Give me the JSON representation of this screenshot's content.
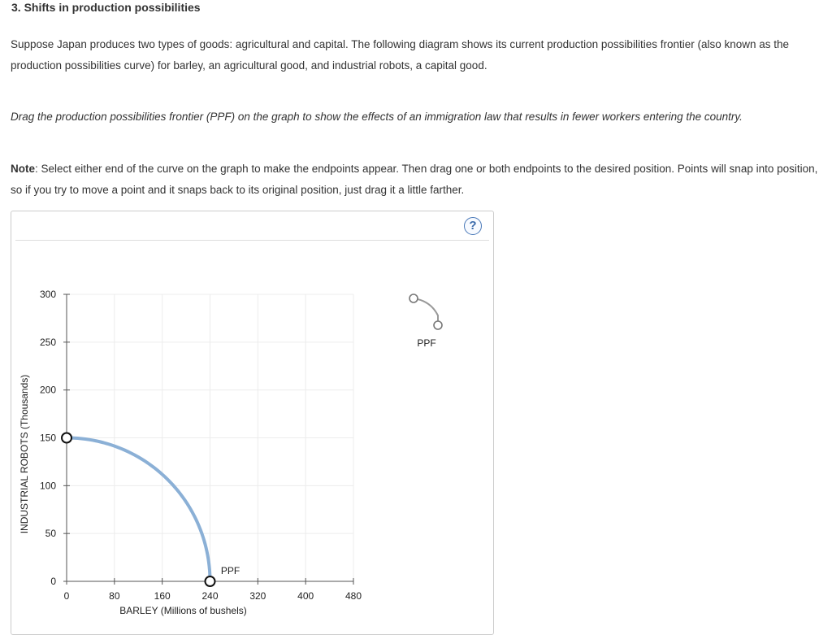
{
  "question": {
    "title": "3. Shifts in production possibilities",
    "intro": "Suppose Japan produces two types of goods: agricultural and capital. The following diagram shows its current production possibilities frontier (also known as the production possibilities curve) for barley, an agricultural good, and industrial robots, a capital good.",
    "instruction": "Drag the production possibilities frontier (PPF) on the graph to show the effects of an immigration law that results in fewer workers entering the country.",
    "note_label": "Note",
    "note_text": ": Select either end of the curve on the graph to make the endpoints appear. Then drag one or both endpoints to the desired position. Points will snap into position, so if you try to move a point and it snaps back to its original position, just drag it a little farther."
  },
  "panel": {
    "help_symbol": "?"
  },
  "graph": {
    "xlabel": "BARLEY (Millions of bushels)",
    "ylabel": "INDUSTRIAL ROBOTS (Thousands)",
    "xticks": [
      0,
      80,
      160,
      240,
      320,
      400,
      480
    ],
    "yticks": [
      0,
      50,
      100,
      150,
      200,
      250,
      300
    ],
    "xlim": [
      0,
      480
    ],
    "ylim": [
      0,
      300
    ],
    "ppf": {
      "label": "PPF",
      "y_intercept": 150,
      "x_intercept": 240,
      "color": "#8bb0d6"
    },
    "palette_tool": {
      "label": "PPF"
    }
  }
}
